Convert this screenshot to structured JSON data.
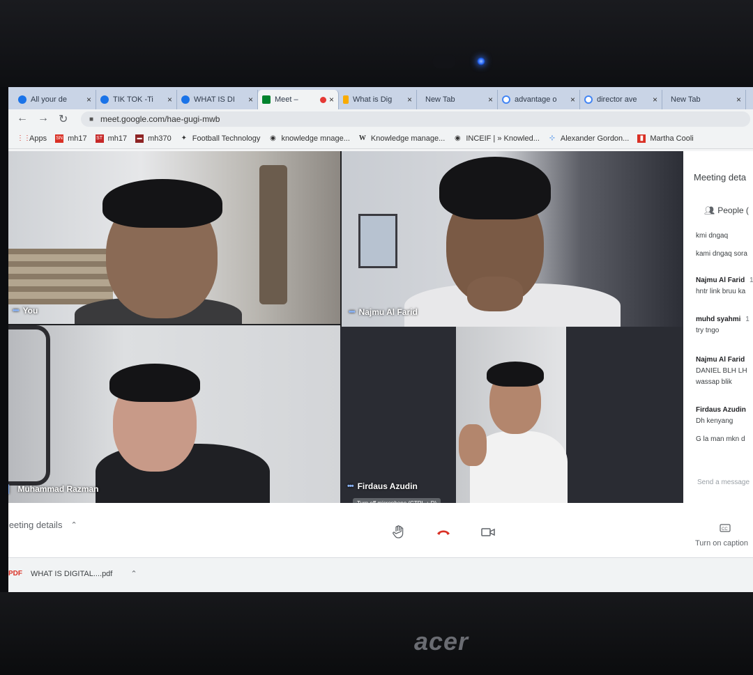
{
  "tabs": [
    {
      "title": "All your de",
      "favicon": "chrome-icon",
      "color": "#1a73e8"
    },
    {
      "title": "TIK TOK -Ti",
      "favicon": "chrome-icon",
      "color": "#1a73e8"
    },
    {
      "title": "WHAT IS DI",
      "favicon": "chrome-icon",
      "color": "#1a73e8"
    },
    {
      "title": "Meet –",
      "favicon": "meet-icon",
      "color": "#00832d",
      "active": true,
      "recording": true
    },
    {
      "title": "What is Dig",
      "favicon": "doc-icon",
      "color": "#f9ab00"
    },
    {
      "title": "New Tab",
      "favicon": "",
      "color": ""
    },
    {
      "title": "advantage o",
      "favicon": "google-icon",
      "color": "#4285f4"
    },
    {
      "title": "director ave",
      "favicon": "google-icon",
      "color": "#4285f4"
    },
    {
      "title": "New Tab",
      "favicon": "",
      "color": ""
    }
  ],
  "address": {
    "url": "meet.google.com/hae-gugi-mwb"
  },
  "bookmarks": [
    {
      "label": "Apps"
    },
    {
      "label": "mh17"
    },
    {
      "label": "mh17"
    },
    {
      "label": "mh370"
    },
    {
      "label": "Football Technology"
    },
    {
      "label": "knowledge mnage..."
    },
    {
      "label": "Knowledge manage..."
    },
    {
      "label": "INCEIF | » Knowled..."
    },
    {
      "label": "Alexander Gordon..."
    },
    {
      "label": "Martha Cooli"
    }
  ],
  "participants": [
    {
      "name": "You"
    },
    {
      "name": "Najmu Al Farid"
    },
    {
      "name": "Muhammad Razman"
    },
    {
      "name": "Firdaus Azudin"
    }
  ],
  "tooltip": "Turn off microphone (CTRL + D)",
  "panel": {
    "title": "Meeting deta",
    "people_label": "People (",
    "messages": [
      {
        "text": "kmi dngaq"
      },
      {
        "text": "kami dngaq sora"
      },
      {
        "sender": "Najmu Al Farid",
        "time": "1"
      },
      {
        "text": "hntr link bruu ka"
      },
      {
        "sender": "muhd syahmi",
        "time": "1"
      },
      {
        "text": "try tngo"
      },
      {
        "sender": "Najmu Al Farid"
      },
      {
        "text": "DANIEL BLH LH"
      },
      {
        "text": "wassap blik"
      },
      {
        "sender": "Firdaus Azudin"
      },
      {
        "text": "Dh kenyang"
      },
      {
        "text": "G la man mkn d"
      }
    ],
    "send_placeholder": "Send a message"
  },
  "controls": {
    "meeting_details": "Meeting details",
    "captions": "Turn on caption"
  },
  "download": {
    "file": "WHAT IS DIGITAL....pdf",
    "type_label": "PDF"
  },
  "brand": "acer",
  "colors": {
    "end_call": "#d93025",
    "meet_accent": "#8ab4f8"
  }
}
